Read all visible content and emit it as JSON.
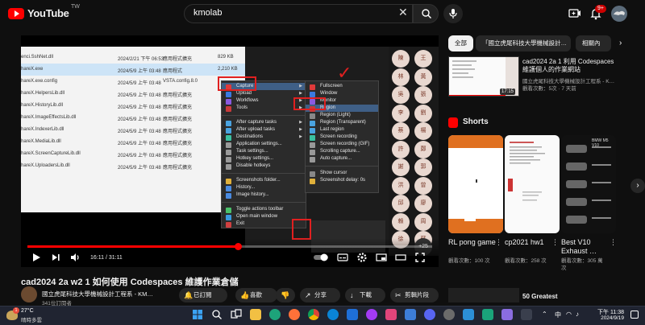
{
  "header": {
    "logo_text": "YouTube",
    "country_code": "TW",
    "search_value": "kmolab",
    "notification_count": "9+"
  },
  "player": {
    "time_display": "16:11 / 31:11",
    "progress_fraction": 0.519,
    "screen_files": [
      {
        "name": "enci.SshNet.dll",
        "date": "2024/2/21 下午 06:53",
        "type": "應用程式擴充",
        "size": "829 KB"
      },
      {
        "name": "hareX.exe",
        "date": "2024/5/9 上午 03:48",
        "type": "應用程式",
        "size": "2,210 KB"
      },
      {
        "name": "hareX.exe.config",
        "date": "2024/5/9 上午 03:48",
        "type": "VSTA.config.8.0",
        "size": ""
      },
      {
        "name": "hareX.HelpersLib.dll",
        "date": "2024/5/9 上午 03:48",
        "type": "應用程式擴充",
        "size": ""
      },
      {
        "name": "hareX.HistoryLib.dll",
        "date": "2024/5/9 上午 03:48",
        "type": "應用程式擴充",
        "size": ""
      },
      {
        "name": "hareX.ImageEffectsLib.dll",
        "date": "2024/5/9 上午 03:48",
        "type": "應用程式擴充",
        "size": ""
      },
      {
        "name": "hareX.IndexerLib.dll",
        "date": "2024/5/9 上午 03:48",
        "type": "應用程式擴充",
        "size": ""
      },
      {
        "name": "hareX.MediaLib.dll",
        "date": "2024/5/9 上午 03:48",
        "type": "應用程式擴充",
        "size": ""
      },
      {
        "name": "hareX.ScreenCaptureLib.dll",
        "date": "2024/5/9 上午 03:48",
        "type": "應用程式擴充",
        "size": ""
      },
      {
        "name": "hareX.UploadersLib.dll",
        "date": "2024/5/9 上午 03:48",
        "type": "應用程式擴充",
        "size": ""
      }
    ],
    "main_menu": [
      "Capture",
      "Upload",
      "Workflows",
      "Tools",
      "",
      "After capture tasks",
      "After upload tasks",
      "Destinations",
      "Application settings...",
      "Task settings...",
      "Hotkey settings...",
      "Disable hotkeys",
      "",
      "Screenshots folder...",
      "History...",
      "Image history...",
      "",
      "Toggle actions toolbar",
      "Open main window",
      "Exit"
    ],
    "capture_submenu": [
      "Fullscreen",
      "Window",
      "Monitor",
      "Region",
      "Region (Light)",
      "Region (Transparent)",
      "Last region",
      "Screen recording",
      "Screen recording (GIF)",
      "Scrolling capture...",
      "Auto capture...",
      "",
      "Show cursor",
      "Screenshot delay: 0s"
    ],
    "avatar_names": [
      "陳",
      "王",
      "林",
      "黃",
      "吳",
      "張",
      "李",
      "劉",
      "蔡",
      "楊",
      "許",
      "鄭",
      "謝",
      "郭",
      "洪",
      "曾",
      "邱",
      "廖",
      "賴",
      "周",
      "徐",
      "蘇"
    ],
    "avatar_extra": "+25"
  },
  "video": {
    "title": "cad2024 2a w2 1 如何使用 Codespaces 維護作業倉儲",
    "channel": "國立虎尾科技大學機械設計工程系 - KM…",
    "subscribers": "341位訂閱者",
    "subscribed_label": "已訂閱",
    "like_label": "喜歡",
    "share_label": "分享",
    "download_label": "下載",
    "clip_label": "剪輯片段"
  },
  "sidebar": {
    "chips": [
      "全部",
      "「國立虎尾科技大學機械設計…",
      "相關內"
    ],
    "rec": {
      "title": "cad2024 2a 1 利用 Codespaces 維護個人的作業網站",
      "channel": "國立虎尾科技大學機械設計工程系 - K…",
      "meta": "觀看次數：5次 · 7 天前",
      "duration": "17:15"
    },
    "shorts_title": "Shorts",
    "shorts": [
      {
        "title": "RL pong game",
        "views": "觀看次數：100 次"
      },
      {
        "title": "cp2021 hw1",
        "views": "觀看次數：258 次"
      },
      {
        "title": "Best V10 Exhaust …",
        "views": "觀看次數：305 萬次"
      }
    ],
    "short3_overlay": "BMW M5 V10",
    "next_title": "50 Greatest"
  },
  "taskbar": {
    "temp": "27°C",
    "weather": "晴時多雲",
    "time": "下午 11:38",
    "date": "2024/9/19",
    "ime": "中",
    "notif_badge": "1"
  },
  "colors": {
    "accent_red": "#ff0000",
    "highlight_red": "#e02020",
    "menu_bg": "#2b2b2b",
    "menu_highlight": "#3f5f86"
  },
  "icons": [
    "youtube-logo-icon",
    "search-icon",
    "mic-icon",
    "create-icon",
    "bell-icon",
    "avatar-icon",
    "play-icon",
    "next-icon",
    "volume-icon",
    "settings-icon",
    "fullscreen-icon",
    "like-icon",
    "dislike-icon",
    "share-icon",
    "download-icon",
    "scissors-icon",
    "more-icon",
    "shorts-icon",
    "windows-start-icon"
  ]
}
